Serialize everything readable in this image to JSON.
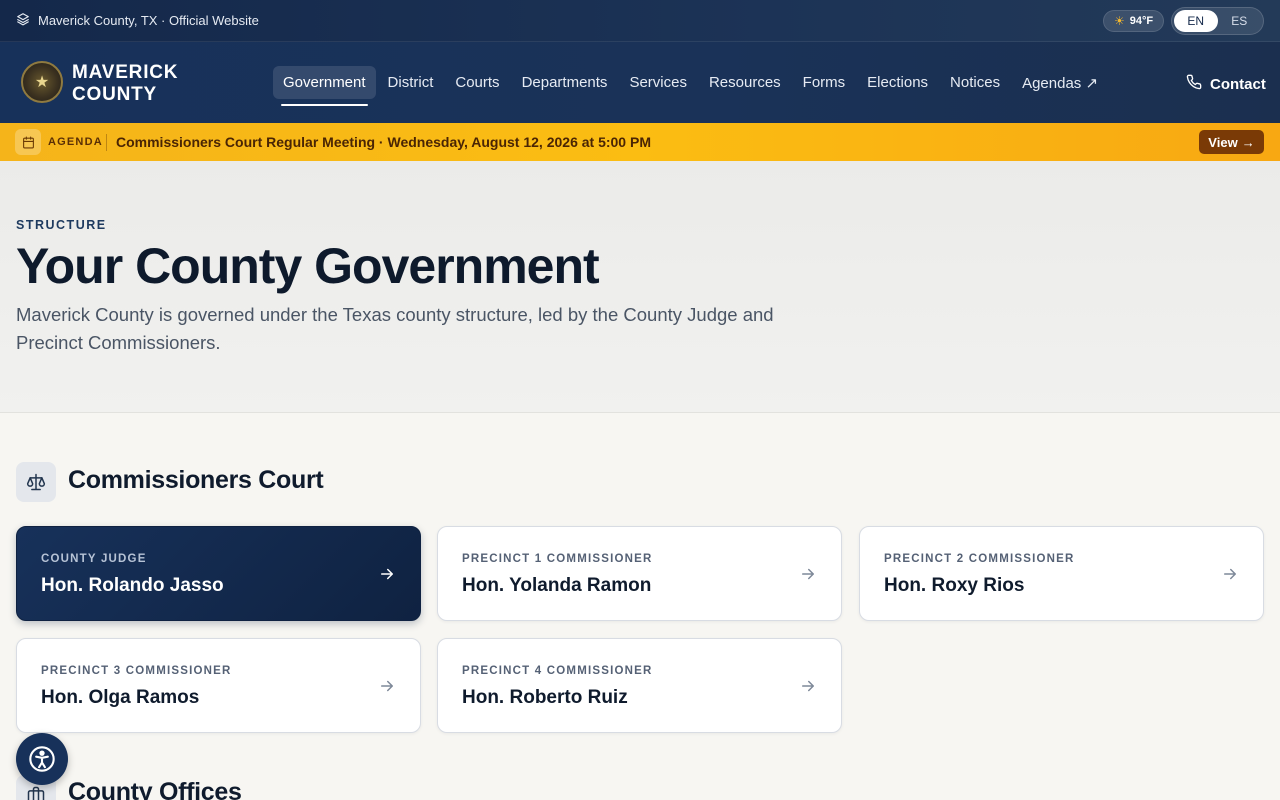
{
  "topbar": {
    "site_label": "Maverick County, TX · Official Website",
    "weather": "94°F",
    "languages": [
      "EN",
      "ES"
    ],
    "active_language": "EN"
  },
  "header": {
    "brand_line1": "MAVERICK",
    "brand_line2": "COUNTY",
    "nav": [
      {
        "label": "Government",
        "active": true
      },
      {
        "label": "District"
      },
      {
        "label": "Courts"
      },
      {
        "label": "Departments"
      },
      {
        "label": "Services"
      },
      {
        "label": "Resources"
      },
      {
        "label": "Forms"
      },
      {
        "label": "Elections"
      },
      {
        "label": "Notices"
      },
      {
        "label": "Agendas ↗"
      }
    ],
    "contact_label": "Contact"
  },
  "banner": {
    "tag": "AGENDA",
    "text": "Commissioners Court Regular Meeting · Wednesday, August 12, 2026 at 5:00 PM",
    "view_label": "View"
  },
  "hero": {
    "eyebrow": "STRUCTURE",
    "title": "Your County Government",
    "description": "Maverick County is governed under the Texas county structure, led by the County Judge and Precinct Commissioners."
  },
  "commissioners": {
    "title": "Commissioners Court",
    "cards": [
      {
        "role": "COUNTY JUDGE",
        "name": "Hon. Rolando Jasso",
        "featured": true
      },
      {
        "role": "PRECINCT 1 COMMISSIONER",
        "name": "Hon. Yolanda Ramon"
      },
      {
        "role": "PRECINCT 2 COMMISSIONER",
        "name": "Hon. Roxy Rios"
      },
      {
        "role": "PRECINCT 3 COMMISSIONER",
        "name": "Hon. Olga Ramos"
      },
      {
        "role": "PRECINCT 4 COMMISSIONER",
        "name": "Hon. Roberto Ruiz"
      }
    ]
  },
  "offices": {
    "title": "County Offices"
  },
  "colors": {
    "navy": "#17315a",
    "banner_yellow": "#fbbd12",
    "banner_button": "#7a3a06"
  },
  "icons": {
    "site": "layers-icon",
    "weather": "sun-icon",
    "contact": "phone-icon",
    "banner": "calendar-icon",
    "section": "scale-icon",
    "offices": "briefcase-icon",
    "accessibility": "accessibility-icon"
  }
}
